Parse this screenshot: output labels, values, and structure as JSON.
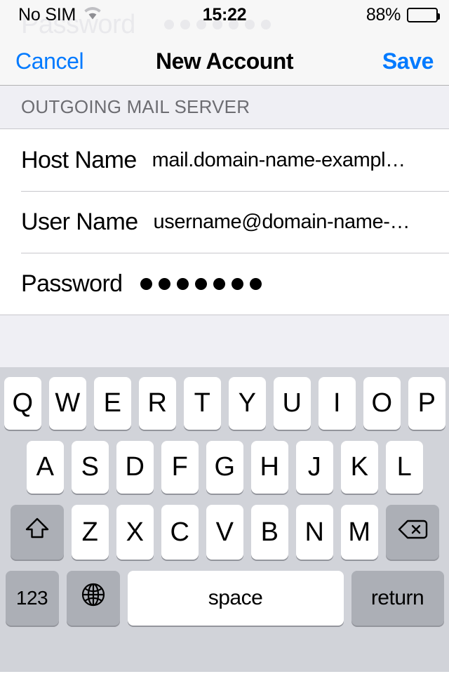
{
  "status_bar": {
    "carrier": "No SIM",
    "wifi_icon": "wifi-icon",
    "time": "15:22",
    "battery_percent": "88%",
    "battery_level": 88,
    "battery_icon": "battery-icon"
  },
  "ghost_overlay": {
    "label": "Password",
    "dot_count": 7,
    "color": "#e9e9ec"
  },
  "nav_bar": {
    "cancel_label": "Cancel",
    "title": "New Account",
    "save_label": "Save",
    "tint_color": "#007aff"
  },
  "section": {
    "header": "OUTGOING MAIL SERVER",
    "rows": [
      {
        "label": "Host Name",
        "value": "mail.domain-name-exampl…",
        "type": "text"
      },
      {
        "label": "User Name",
        "value": "username@domain-name-…",
        "type": "text"
      },
      {
        "label": "Password",
        "value": "",
        "type": "password",
        "dot_count": 7
      }
    ]
  },
  "keyboard": {
    "layout": "qwerty-uppercase",
    "shift_active": true,
    "row1": [
      "Q",
      "W",
      "E",
      "R",
      "T",
      "Y",
      "U",
      "I",
      "O",
      "P"
    ],
    "row2": [
      "A",
      "S",
      "D",
      "F",
      "G",
      "H",
      "J",
      "K",
      "L"
    ],
    "row3_letters": [
      "Z",
      "X",
      "C",
      "V",
      "B",
      "N",
      "M"
    ],
    "shift_icon": "shift-arrow-icon",
    "delete_icon": "delete-backspace-icon",
    "numbers_label": "123",
    "globe_icon": "globe-icon",
    "space_label": "space",
    "return_label": "return",
    "key_bg": "#ffffff",
    "modifier_bg": "#acafb6",
    "keyboard_bg": "#d1d3d9"
  }
}
